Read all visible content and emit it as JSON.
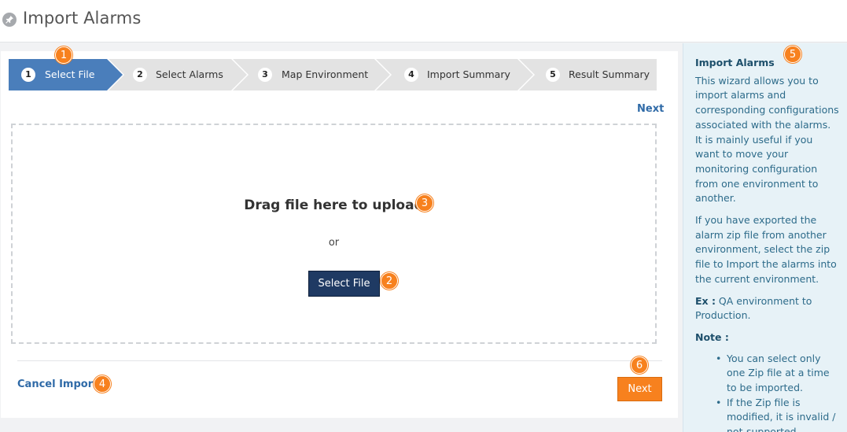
{
  "header": {
    "title": "Import Alarms",
    "icon": "pin-icon"
  },
  "stepper": {
    "steps": [
      {
        "num": "1",
        "label": "Select File"
      },
      {
        "num": "2",
        "label": "Select Alarms"
      },
      {
        "num": "3",
        "label": "Map Environment"
      },
      {
        "num": "4",
        "label": "Import Summary"
      },
      {
        "num": "5",
        "label": "Result Summary"
      }
    ],
    "active_index": 0
  },
  "actions": {
    "next_top": "Next",
    "cancel": "Cancel Import",
    "next_button": "Next"
  },
  "dropzone": {
    "title": "Drag file here to upload",
    "or": "or",
    "select_button": "Select File"
  },
  "callouts": [
    "1",
    "2",
    "3",
    "4",
    "5",
    "6"
  ],
  "help": {
    "title": "Import Alarms",
    "p1": "This wizard allows you to import alarms and corresponding configurations associated with the alarms. It is mainly useful if you want to move your monitoring configuration from one environment to another.",
    "p2": "If you have exported the alarm zip file from another environment, select the zip file to Import the alarms into the current environment.",
    "ex_label": "Ex :",
    "ex_text": " QA environment to Production.",
    "note_label": "Note :",
    "notes": [
      "You can select only one Zip file at a time to be imported.",
      "If the Zip file is modified, it is invalid / not-supported."
    ]
  },
  "colors": {
    "accent_orange": "#f7811e",
    "active_step": "#4a7ebb",
    "select_button": "#1f3a63",
    "link": "#2f6aa7",
    "help_bg": "#e7f2f7"
  }
}
